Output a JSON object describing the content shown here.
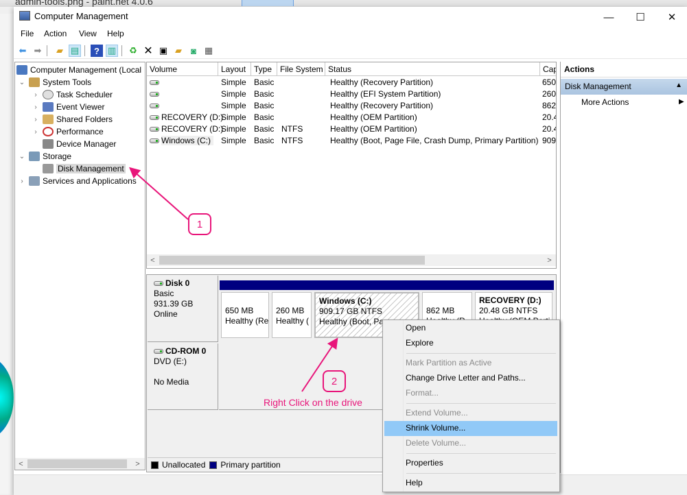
{
  "background_app": {
    "title": "admin-tools.png - paint.net 4.0.6"
  },
  "window": {
    "title": "Computer Management",
    "controls": {
      "minimize": "—",
      "maximize": "☐",
      "close": "✕"
    }
  },
  "menu": [
    "File",
    "Action",
    "View",
    "Help"
  ],
  "toolbar": [
    "back-arrow",
    "forward-arrow",
    "up-folder",
    "show-hide-console-tree",
    "help",
    "show-hide-action-pane",
    "refresh",
    "delete",
    "properties",
    "open",
    "search",
    "settings"
  ],
  "tree": {
    "items": [
      {
        "label": "Computer Management (Local",
        "expander": "",
        "level": 0
      },
      {
        "label": "System Tools",
        "expander": "⌄",
        "level": 1
      },
      {
        "label": "Task Scheduler",
        "expander": "›",
        "level": 2
      },
      {
        "label": "Event Viewer",
        "expander": "›",
        "level": 2
      },
      {
        "label": "Shared Folders",
        "expander": "›",
        "level": 2
      },
      {
        "label": "Performance",
        "expander": "›",
        "level": 2
      },
      {
        "label": "Device Manager",
        "expander": "",
        "level": 2
      },
      {
        "label": "Storage",
        "expander": "⌄",
        "level": 1
      },
      {
        "label": "Disk Management",
        "expander": "",
        "level": 2,
        "selected": true
      },
      {
        "label": "Services and Applications",
        "expander": "›",
        "level": 1
      }
    ]
  },
  "volume_list": {
    "columns": [
      "Volume",
      "Layout",
      "Type",
      "File System",
      "Status",
      "Cap"
    ],
    "rows": [
      {
        "volume": "",
        "layout": "Simple",
        "type": "Basic",
        "fs": "",
        "status": "Healthy (Recovery Partition)",
        "cap": "650"
      },
      {
        "volume": "",
        "layout": "Simple",
        "type": "Basic",
        "fs": "",
        "status": "Healthy (EFI System Partition)",
        "cap": "260"
      },
      {
        "volume": "",
        "layout": "Simple",
        "type": "Basic",
        "fs": "",
        "status": "Healthy (Recovery Partition)",
        "cap": "862"
      },
      {
        "volume": "RECOVERY (D:)",
        "layout": "Simple",
        "type": "Basic",
        "fs": "",
        "status": "Healthy (OEM Partition)",
        "cap": "20.4"
      },
      {
        "volume": "RECOVERY (D:)",
        "layout": "Simple",
        "type": "Basic",
        "fs": "NTFS",
        "status": "Healthy (OEM Partition)",
        "cap": "20.4"
      },
      {
        "volume": "Windows (C:)",
        "layout": "Simple",
        "type": "Basic",
        "fs": "NTFS",
        "status": "Healthy (Boot, Page File, Crash Dump, Primary Partition)",
        "cap": "909"
      }
    ]
  },
  "disks": [
    {
      "name": "Disk 0",
      "type": "Basic",
      "size": "931.39 GB",
      "state": "Online"
    },
    {
      "name": "CD-ROM 0",
      "type": "DVD (E:)",
      "size": "",
      "state": "No Media"
    }
  ],
  "partitions": [
    {
      "title": "",
      "size": "650 MB",
      "status": "Healthy (Re"
    },
    {
      "title": "",
      "size": "260 MB",
      "status": "Healthy ("
    },
    {
      "title": "Windows  (C:)",
      "size": "909.17 GB NTFS",
      "status": "Healthy (Boot, Pa",
      "selected": true
    },
    {
      "title": "",
      "size": "862 MB",
      "status": "Healthy (R"
    },
    {
      "title": "RECOVERY  (D:)",
      "size": "20.48 GB NTFS",
      "status": "Healthy (OEM Parti"
    }
  ],
  "legend": [
    {
      "label": "Unallocated",
      "color": "#000000"
    },
    {
      "label": "Primary partition",
      "color": "#000080"
    }
  ],
  "actions": {
    "header": "Actions",
    "section": "Disk Management",
    "section_icon": "▲",
    "more": "More Actions",
    "more_icon": "▶"
  },
  "context_menu": [
    {
      "label": "Open",
      "disabled": false
    },
    {
      "label": "Explore",
      "disabled": false
    },
    {
      "sep": true
    },
    {
      "label": "Mark Partition as Active",
      "disabled": true
    },
    {
      "label": "Change Drive Letter and Paths...",
      "disabled": false
    },
    {
      "label": "Format...",
      "disabled": true
    },
    {
      "sep": true
    },
    {
      "label": "Extend Volume...",
      "disabled": true
    },
    {
      "label": "Shrink Volume...",
      "disabled": false,
      "highlighted": true
    },
    {
      "label": "Delete Volume...",
      "disabled": true
    },
    {
      "sep": true
    },
    {
      "label": "Properties",
      "disabled": false
    },
    {
      "sep": true
    },
    {
      "label": "Help",
      "disabled": false
    }
  ],
  "annotations": {
    "callout1": "1",
    "callout2": "2",
    "text": "Right Click on the drive",
    "color": "#e8157a"
  }
}
